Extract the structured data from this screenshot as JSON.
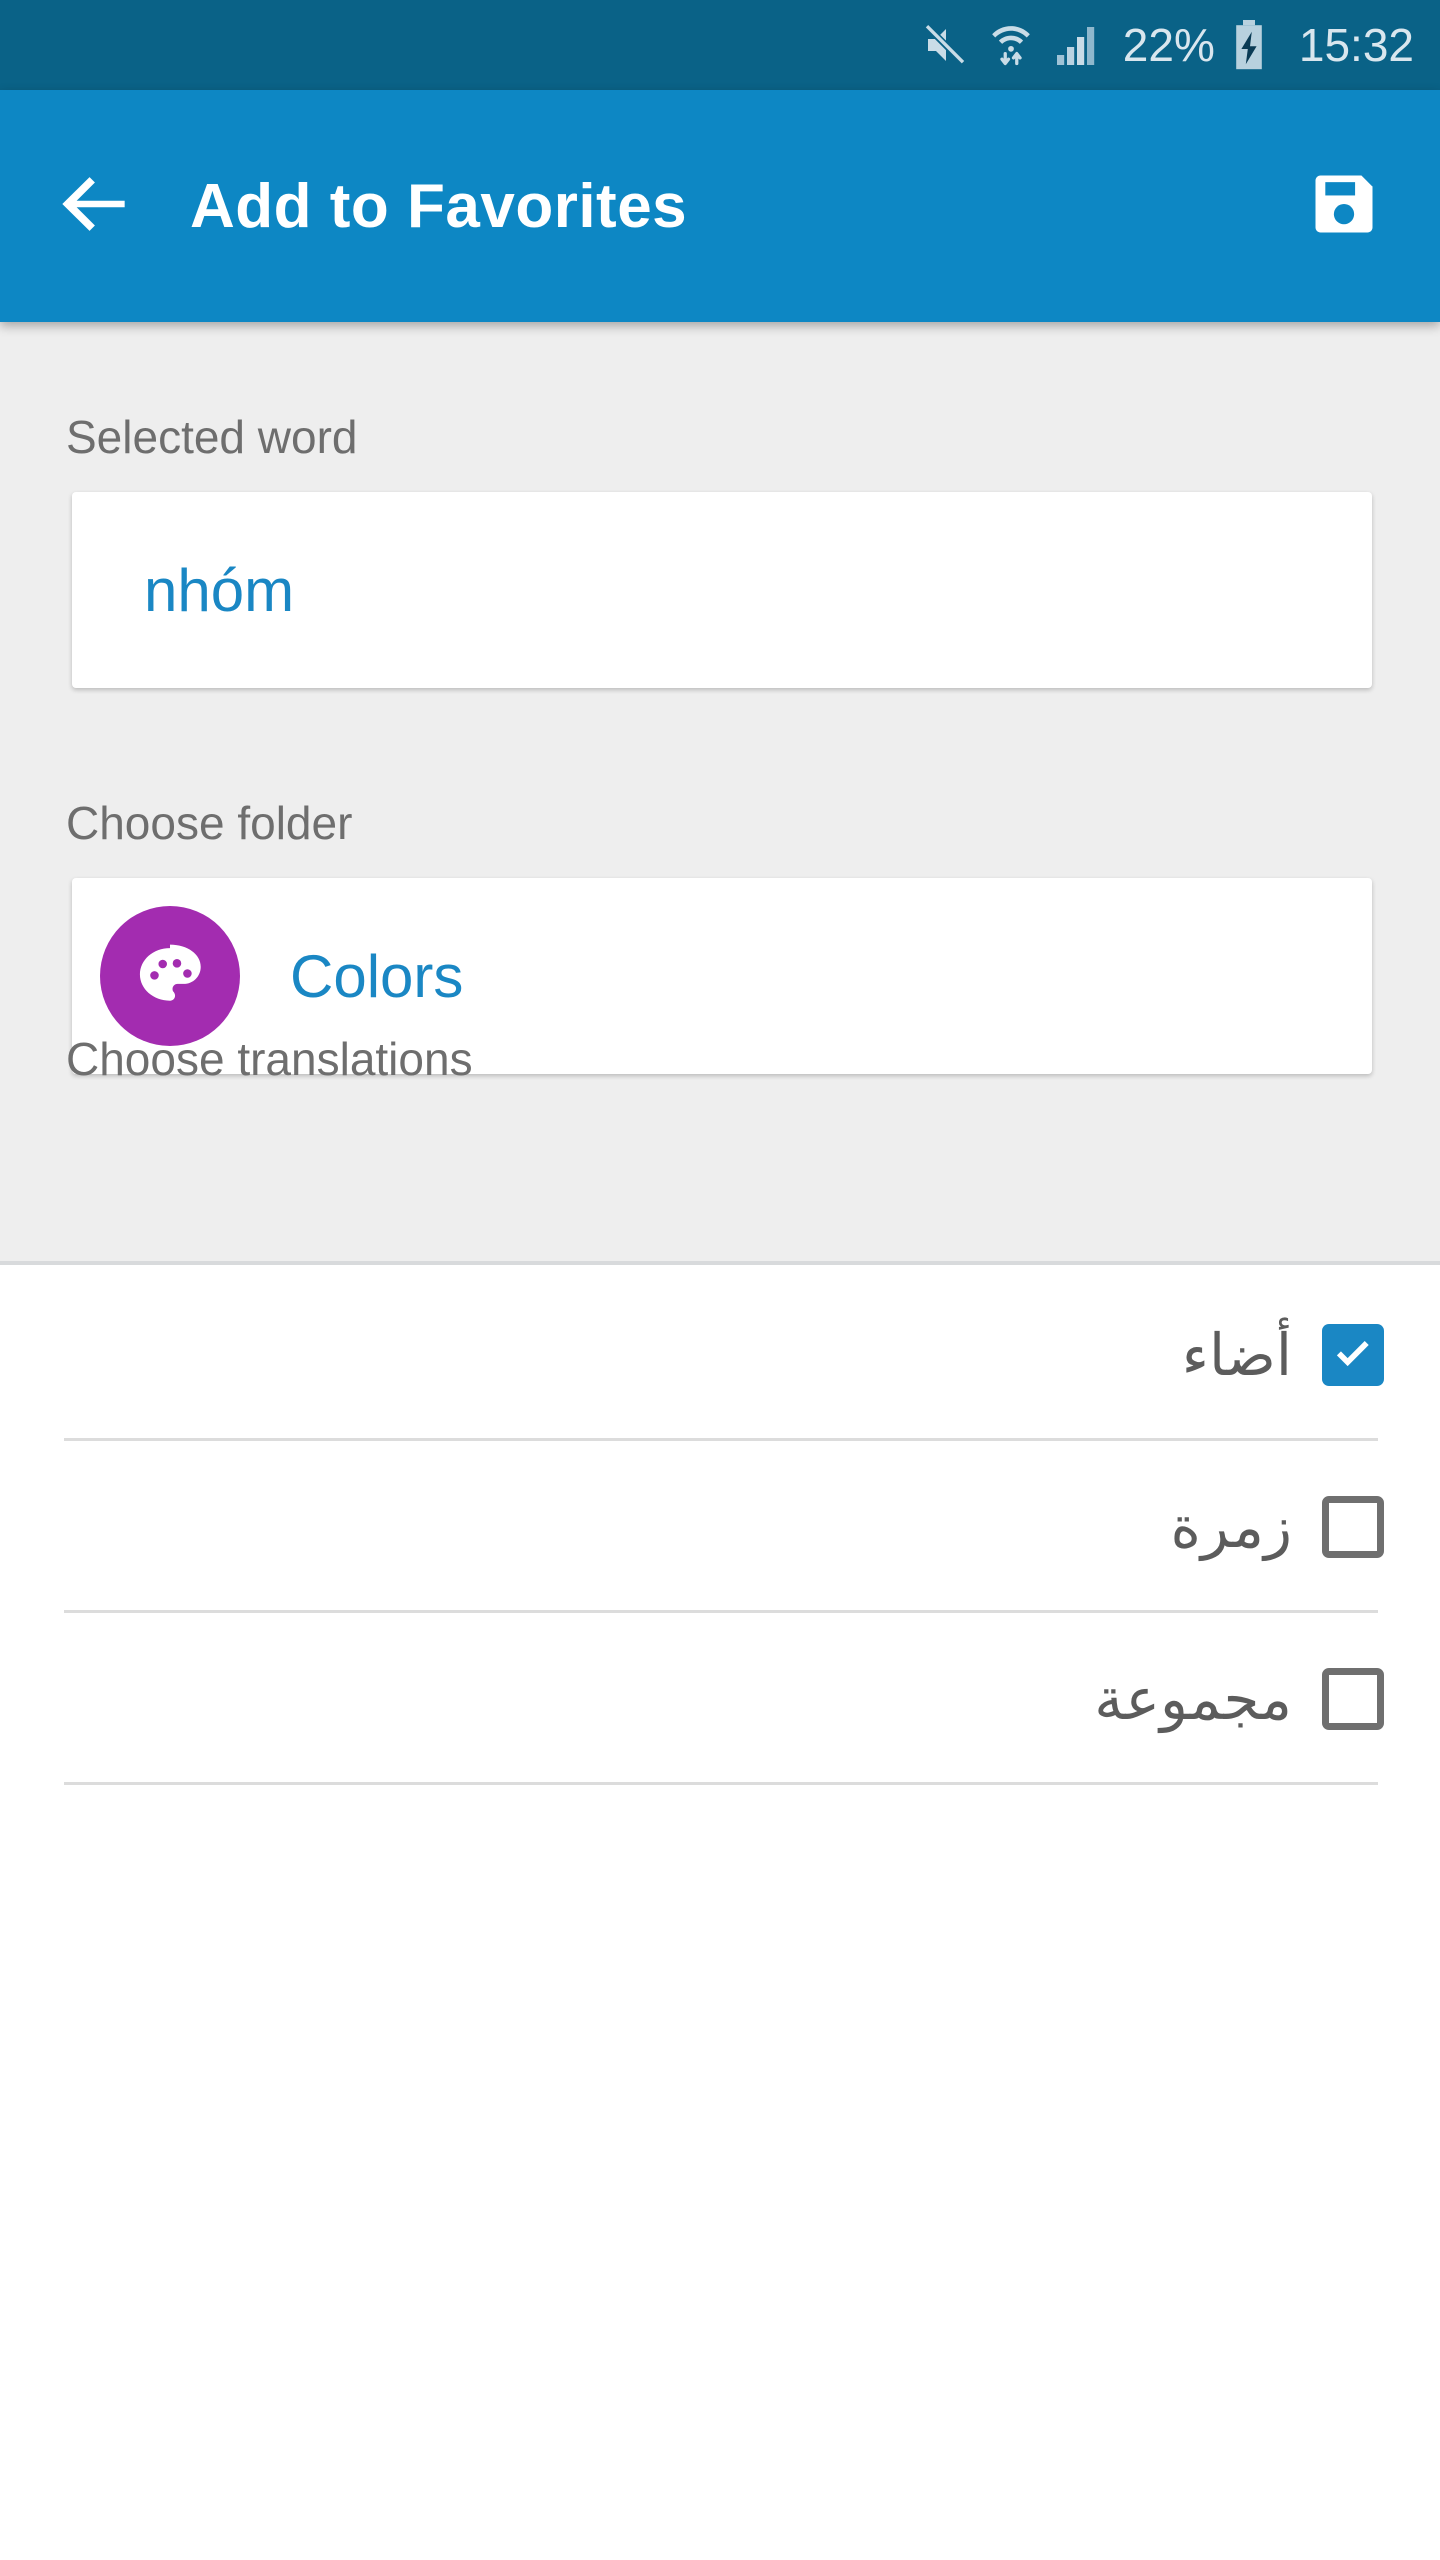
{
  "status_bar": {
    "battery_percent": "22%",
    "time": "15:32",
    "icons": [
      "mute-icon",
      "wifi-icon",
      "signal-icon",
      "battery-charging-icon"
    ],
    "background_color": "#0a6287",
    "text_color": "#d9e6ee"
  },
  "app_bar": {
    "title": "Add to Favorites",
    "back_icon": "back-arrow-icon",
    "save_icon": "save-floppy-icon",
    "background_color": "#0d87c4"
  },
  "form": {
    "selected_word_label": "Selected word",
    "selected_word_value": "nhóm",
    "choose_folder_label": "Choose folder",
    "folder_name": "Colors",
    "folder_icon": "palette-icon",
    "folder_icon_color": "#a32cb0",
    "choose_translations_label": "Choose translations",
    "value_color": "#1a87c4",
    "label_color": "#6e6e6e",
    "background_color": "#eeeeee"
  },
  "translations": [
    {
      "text": "أضاء",
      "checked": true
    },
    {
      "text": "زمرة",
      "checked": false
    },
    {
      "text": "مجموعة",
      "checked": false
    }
  ],
  "colors": {
    "accent": "#1a87c4",
    "checked_checkbox": "#1a87c4",
    "unchecked_checkbox_border": "#6f6f6f",
    "divider": "#dcdcdc"
  }
}
